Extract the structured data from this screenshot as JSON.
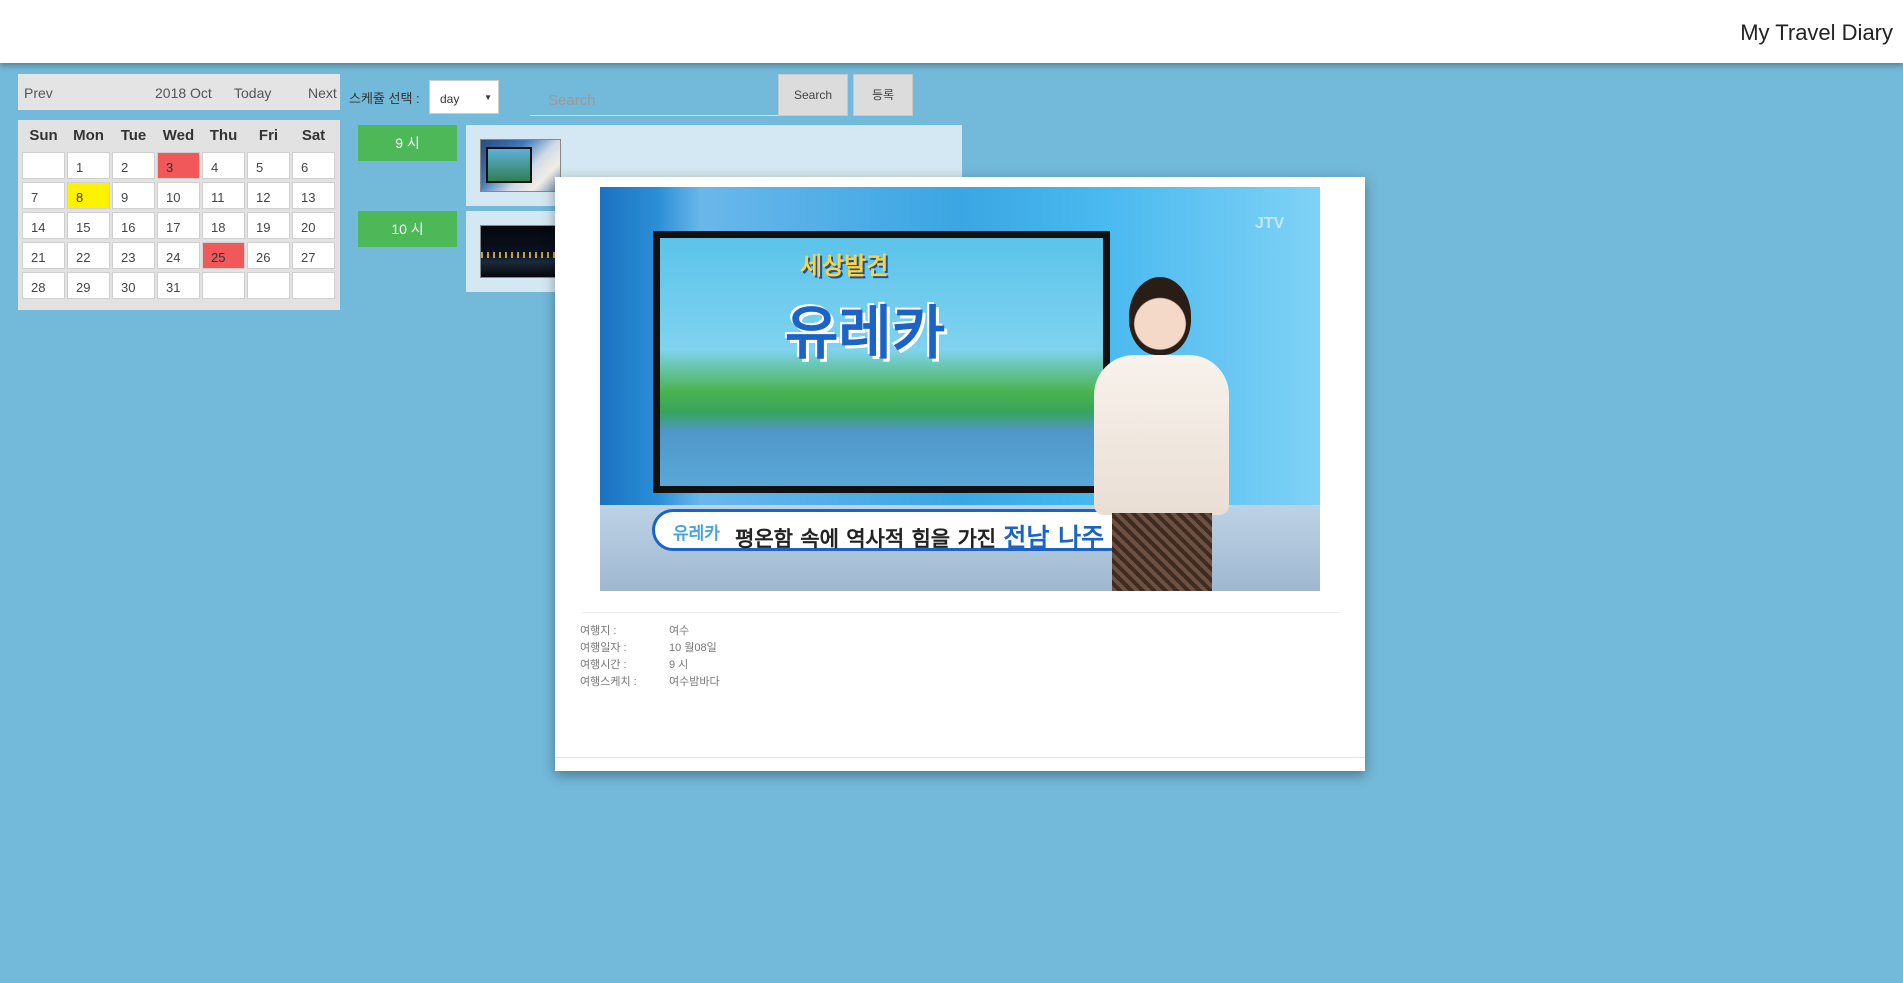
{
  "app": {
    "title": "My Travel Diary"
  },
  "calendar": {
    "nav": {
      "prev": "Prev",
      "month": "2018 Oct",
      "today": "Today",
      "next": "Next"
    },
    "weekdays": [
      "Sun",
      "Mon",
      "Tue",
      "Wed",
      "Thu",
      "Fri",
      "Sat"
    ],
    "weeks": [
      [
        "",
        "1",
        "2",
        "3",
        "4",
        "5",
        "6"
      ],
      [
        "7",
        "8",
        "9",
        "10",
        "11",
        "12",
        "13"
      ],
      [
        "14",
        "15",
        "16",
        "17",
        "18",
        "19",
        "20"
      ],
      [
        "21",
        "22",
        "23",
        "24",
        "25",
        "26",
        "27"
      ],
      [
        "28",
        "29",
        "30",
        "31",
        "",
        "",
        ""
      ]
    ],
    "highlights": {
      "red": [
        "3",
        "25"
      ],
      "yellow": [
        "8"
      ]
    },
    "colors": {
      "red": "#f0585a",
      "yellow": "#fff200"
    }
  },
  "toolbar": {
    "schedule_label": "스케쥴 선택 :",
    "view_select": "day",
    "search_placeholder": "Search",
    "search_button": "Search",
    "register_button": "등록"
  },
  "schedule": [
    {
      "hour": "9 시",
      "thumbnail": "tv-show-thumbnail"
    },
    {
      "hour": "10 시",
      "thumbnail": "night-view-thumbnail"
    }
  ],
  "modal": {
    "image": {
      "show_subtitle": "세상발견",
      "show_title": "유레카",
      "caption_logo": "유레카",
      "caption_text": "평온함 속에 역사적 힘을 가진",
      "caption_highlight": "전남 나주",
      "channel": "JTV"
    },
    "info": [
      {
        "label": "여행지 :",
        "value": "여수"
      },
      {
        "label": "여행일자 :",
        "value": "10 월08일"
      },
      {
        "label": "여행시간 :",
        "value": "9 시"
      },
      {
        "label": "여행스케치 :",
        "value": "여수밤바다"
      }
    ]
  },
  "colors": {
    "background": "#73b9d9",
    "hour_badge": "#4cb858",
    "slot": "#d3e8f2"
  }
}
